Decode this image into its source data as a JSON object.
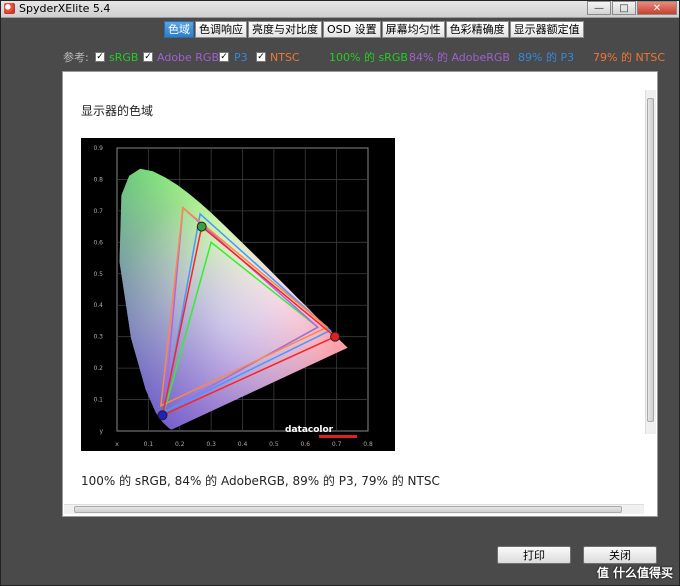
{
  "window": {
    "title": "SpyderXElite 5.4"
  },
  "titlebar_buttons": {
    "minimize": "—",
    "maximize": "□",
    "close": "✕"
  },
  "tabs": [
    {
      "label": "色域",
      "active": true
    },
    {
      "label": "色调响应",
      "active": false
    },
    {
      "label": "亮度与对比度",
      "active": false
    },
    {
      "label": "OSD 设置",
      "active": false
    },
    {
      "label": "屏幕均匀性",
      "active": false
    },
    {
      "label": "色彩精确度",
      "active": false
    },
    {
      "label": "显示器额定值",
      "active": false
    }
  ],
  "reference": {
    "label": "参考:",
    "items": [
      {
        "label": "sRGB",
        "checked": true,
        "color": "#22cc22"
      },
      {
        "label": "Adobe RGB",
        "checked": true,
        "color": "#a060d0"
      },
      {
        "label": "P3",
        "checked": true,
        "color": "#3388dd"
      },
      {
        "label": "NTSC",
        "checked": true,
        "color": "#ee7733"
      }
    ],
    "results": [
      {
        "text": "100% 的 sRGB",
        "color": "#22cc22"
      },
      {
        "text": "84% 的 AdobeRGB",
        "color": "#a060d0"
      },
      {
        "text": "89% 的 P3",
        "color": "#3388dd"
      },
      {
        "text": "79% 的 NTSC",
        "color": "#ee7733"
      }
    ],
    "checkmark": "✓"
  },
  "panel": {
    "title": "显示器的色域",
    "summary": "100% 的 sRGB, 84% 的 AdobeRGB, 89% 的 P3, 79% 的 NTSC"
  },
  "chart_data": {
    "type": "scatter",
    "x_ticks": [
      "x",
      "0.1",
      "0.2",
      "0.3",
      "0.4",
      "0.5",
      "0.6",
      "0.7",
      "0.8"
    ],
    "y_ticks": [
      "0.9",
      "0.8",
      "0.7",
      "0.6",
      "0.5",
      "0.4",
      "0.3",
      "0.2",
      "0.1",
      "y"
    ],
    "xlim": [
      0,
      0.8
    ],
    "ylim": [
      0,
      0.9
    ],
    "grid": true,
    "brand": "datacolor",
    "gamuts": [
      {
        "name": "sRGB",
        "color": "#33ee33",
        "points": [
          [
            0.64,
            0.33
          ],
          [
            0.3,
            0.6
          ],
          [
            0.15,
            0.06
          ]
        ]
      },
      {
        "name": "Adobe RGB",
        "color": "#aa66ee",
        "points": [
          [
            0.64,
            0.33
          ],
          [
            0.21,
            0.71
          ],
          [
            0.15,
            0.06
          ]
        ]
      },
      {
        "name": "P3",
        "color": "#4499ff",
        "points": [
          [
            0.68,
            0.32
          ],
          [
            0.265,
            0.69
          ],
          [
            0.15,
            0.06
          ]
        ]
      },
      {
        "name": "NTSC",
        "color": "#ff8844",
        "points": [
          [
            0.67,
            0.33
          ],
          [
            0.21,
            0.71
          ],
          [
            0.14,
            0.08
          ]
        ]
      },
      {
        "name": "Display",
        "color": "#ff2222",
        "points": [
          [
            0.695,
            0.3
          ],
          [
            0.27,
            0.65
          ],
          [
            0.145,
            0.05
          ]
        ]
      }
    ],
    "primaries": [
      {
        "name": "red",
        "color": "#e02020",
        "point": [
          0.695,
          0.3
        ]
      },
      {
        "name": "green",
        "color": "#3aa040",
        "point": [
          0.27,
          0.65
        ]
      },
      {
        "name": "blue",
        "color": "#2020c0",
        "point": [
          0.145,
          0.05
        ]
      }
    ]
  },
  "buttons": {
    "print": "打印",
    "close": "关闭"
  },
  "watermark": "值 什么值得买"
}
